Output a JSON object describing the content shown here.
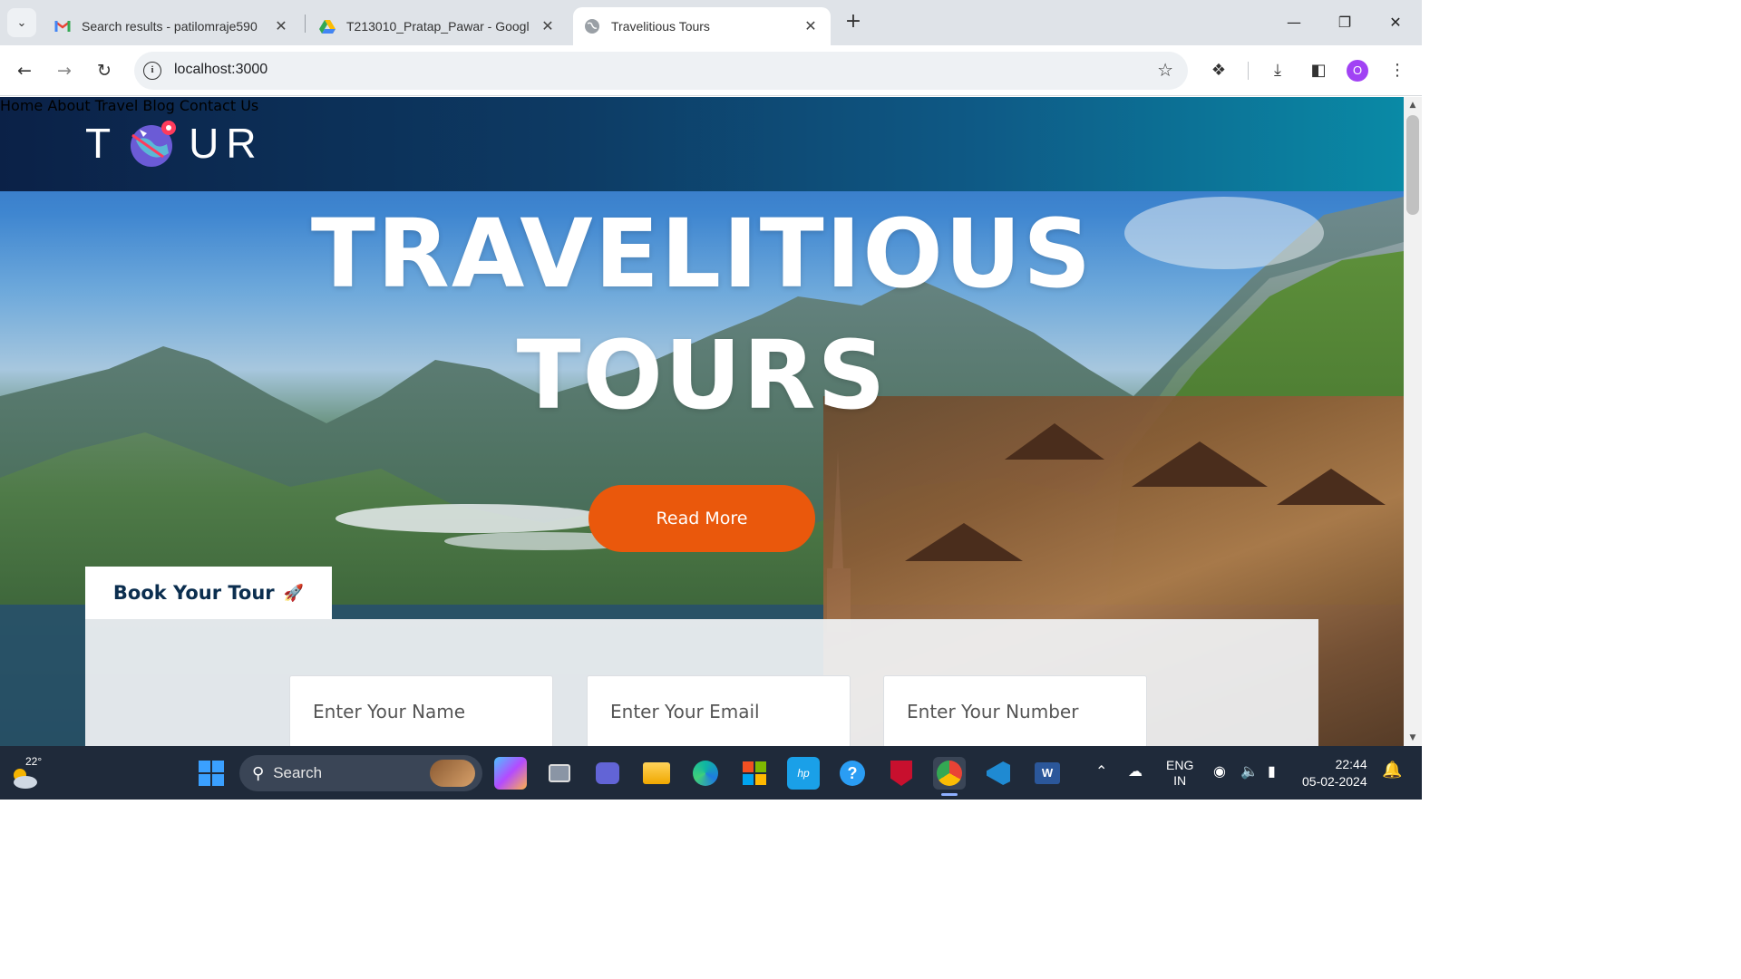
{
  "browser": {
    "tabs": [
      {
        "title": "Search results - patilomraje590",
        "favicon": "gmail-icon",
        "active": false
      },
      {
        "title": "T213010_Pratap_Pawar - Googl",
        "favicon": "google-drive-icon",
        "active": false
      },
      {
        "title": "Travelitious Tours",
        "favicon": "globe-icon",
        "active": true
      }
    ],
    "url": "localhost:3000",
    "profile_initial": "O"
  },
  "site": {
    "logo": {
      "left": "T",
      "right": "UR"
    },
    "nav": [
      "Home",
      "About",
      "Travel",
      "Blog",
      "Contact Us"
    ],
    "hero": {
      "line1": "TRAVELITIOUS",
      "line2": "TOURS",
      "button": "Read More"
    },
    "booking": {
      "tab_label": "Book Your Tour",
      "placeholders": {
        "name": "Enter Your Name",
        "email": "Enter Your Email",
        "number": "Enter Your Number"
      }
    },
    "colors": {
      "header_start": "#0b2147",
      "header_end": "#0a8aa6",
      "accent": "#ea580c",
      "book_text": "#0b2e4f"
    }
  },
  "taskbar": {
    "weather_temp": "22°",
    "search_label": "Search",
    "lang_line1": "ENG",
    "lang_line2": "IN",
    "time": "22:44",
    "date": "05-02-2024"
  }
}
